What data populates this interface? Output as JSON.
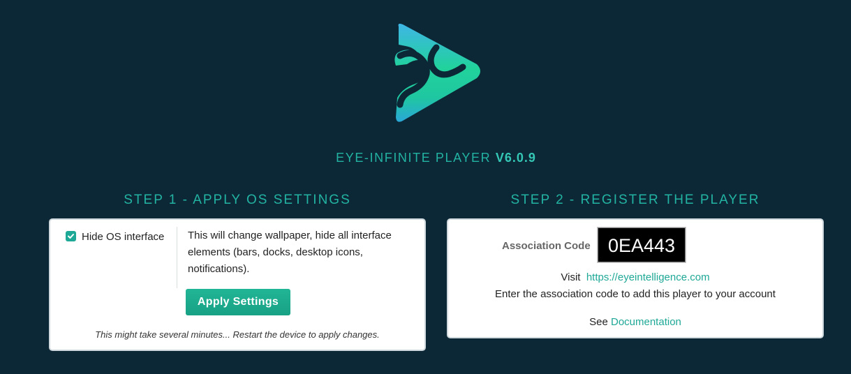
{
  "header": {
    "app_name": "EYE-INFINITE PLAYER",
    "version": "V6.0.9"
  },
  "step1": {
    "heading": "STEP 1 - APPLY OS SETTINGS",
    "checkbox_label": "Hide OS interface",
    "checkbox_checked": true,
    "description": "This will change wallpaper, hide all interface elements (bars, docks, desktop icons, notifications).",
    "button_label": "Apply Settings",
    "note": "This might take several minutes... Restart the device to apply changes."
  },
  "step2": {
    "heading": "STEP 2 - REGISTER THE PLAYER",
    "association_label": "Association Code",
    "association_code": "0EA443",
    "visit_prefix": "Visit",
    "visit_link": "https://eyeintelligence.com",
    "instruction": "Enter the association code to add this player to your account",
    "see_prefix": "See",
    "doc_link": "Documentation"
  },
  "colors": {
    "background": "#0c2836",
    "accent": "#23b3a2",
    "button": "#1aa98c"
  },
  "icons": {
    "logo": "eye-infinite-logo-icon",
    "checkbox": "checkmark-icon"
  }
}
